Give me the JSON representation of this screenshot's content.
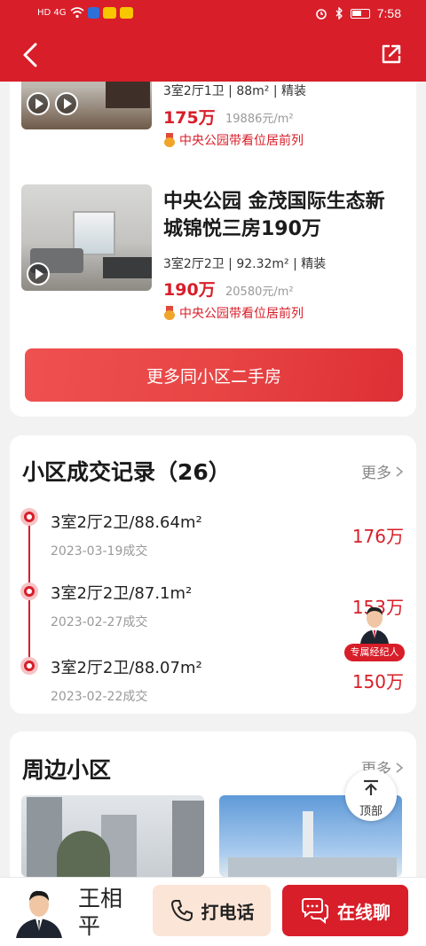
{
  "status_bar": {
    "time": "7:58",
    "network": "HD 4G"
  },
  "listings": [
    {
      "title": "",
      "meta": "3室2厅1卫 | 88m² | 精装",
      "price": "175万",
      "unit_price": "19886元/m²",
      "tag": "中央公园带看位居前列"
    },
    {
      "title": "中央公园 金茂国际生态新城锦悦三房190万",
      "meta": "3室2厅2卫 | 92.32m² | 精装",
      "price": "190万",
      "unit_price": "20580元/m²",
      "tag": "中央公园带看位居前列"
    }
  ],
  "more_secondhand_label": "更多同小区二手房",
  "transactions": {
    "title": "小区成交记录（26）",
    "more_label": "更多",
    "records": [
      {
        "title": "3室2厅2卫/88.64m²",
        "date": "2023-03-19成交",
        "price": "176万"
      },
      {
        "title": "3室2厅2卫/87.1m²",
        "date": "2023-02-27成交",
        "price": "153万"
      },
      {
        "title": "3室2厅2卫/88.07m²",
        "date": "2023-02-22成交",
        "price": "150万"
      }
    ]
  },
  "agent_float_label": "专属经纪人",
  "nearby": {
    "title": "周边小区",
    "more_label": "更多"
  },
  "back_to_top_label": "顶部",
  "bottom_bar": {
    "agent_name": "王相平",
    "call_label": "打电话",
    "chat_label": "在线聊"
  }
}
